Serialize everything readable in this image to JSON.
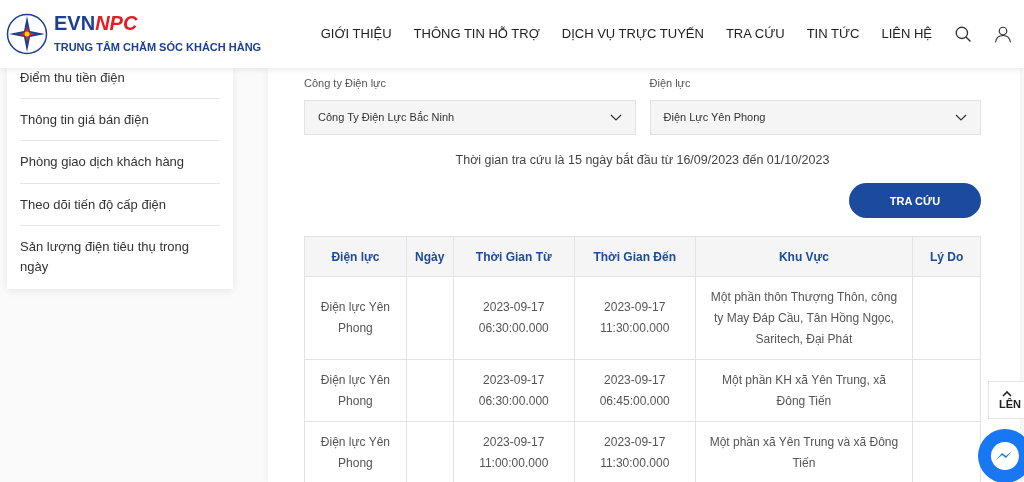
{
  "header": {
    "brand_left": "EVN",
    "brand_right": "NPC",
    "tagline": "TRUNG TÂM CHĂM SÓC KHÁCH HÀNG",
    "nav": [
      "GIỚI THIỆU",
      "THÔNG TIN HỖ TRỢ",
      "DỊCH VỤ TRỰC TUYẾN",
      "TRA CỨU",
      "TIN TỨC",
      "LIÊN HỆ"
    ]
  },
  "sidebar": {
    "items": [
      "Điểm thu tiền điện",
      "Thông tin giá bán điện",
      "Phòng giao dịch khách hàng",
      "Theo dõi tiến độ cấp điện",
      "Sản lượng điện tiêu thụ trong ngày"
    ]
  },
  "filters": [
    {
      "label": "Công ty Điện lực",
      "value": "Công Ty Điện Lực Bắc Ninh"
    },
    {
      "label": "Điện lực",
      "value": "Điện Lực Yên Phong"
    }
  ],
  "notice": "Thời gian tra cứu là 15 ngày bắt đầu từ 16/09/2023 đến 01/10/2023",
  "search_button": "TRA CỨU",
  "table": {
    "columns": [
      "Điện lực",
      "Ngày",
      "Thời Gian Từ",
      "Thời Gian Đến",
      "Khu Vực",
      "Lý Do"
    ],
    "rows": [
      [
        "Điện lực Yên Phong",
        "",
        "2023-09-17 06:30:00.000",
        "2023-09-17 11:30:00.000",
        "Một phần thôn Thượng Thôn, công ty May Đáp Cầu, Tân Hồng Ngọc, Saritech, Đại Phát",
        ""
      ],
      [
        "Điện lực Yên Phong",
        "",
        "2023-09-17 06:30:00.000",
        "2023-09-17 06:45:00.000",
        "Một phần KH xã Yên Trung, xã Đông Tiến",
        ""
      ],
      [
        "Điện lực Yên Phong",
        "",
        "2023-09-17 11:00:00.000",
        "2023-09-17 11:30:00.000",
        "Một phần xã Yên Trung và xã Đông Tiến",
        ""
      ]
    ]
  },
  "back_to_top": "LÊN"
}
